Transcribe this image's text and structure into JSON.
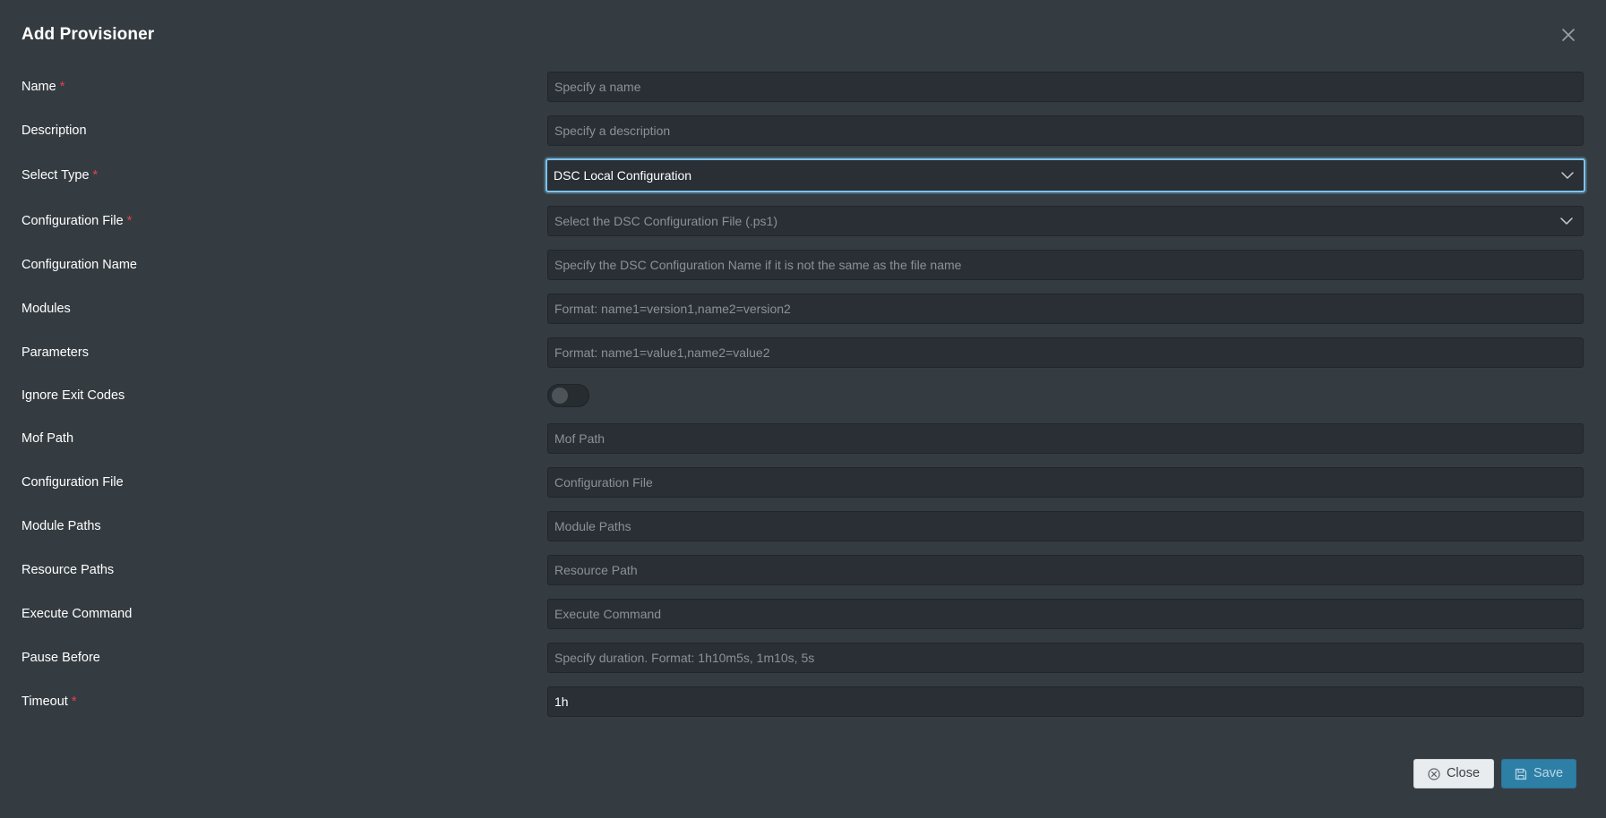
{
  "modal": {
    "title": "Add Provisioner"
  },
  "fields": {
    "name": {
      "label": "Name",
      "placeholder": "Specify a name",
      "required": "*"
    },
    "description": {
      "label": "Description",
      "placeholder": "Specify a description"
    },
    "select_type": {
      "label": "Select Type",
      "value": "DSC Local Configuration",
      "required": "*"
    },
    "configuration_file_select": {
      "label": "Configuration File",
      "placeholder": "Select the DSC Configuration File (.ps1)",
      "required": "*"
    },
    "configuration_name": {
      "label": "Configuration Name",
      "placeholder": "Specify the DSC Configuration Name if it is not the same as the file name"
    },
    "modules": {
      "label": "Modules",
      "placeholder": "Format: name1=version1,name2=version2"
    },
    "parameters": {
      "label": "Parameters",
      "placeholder": "Format: name1=value1,name2=value2"
    },
    "ignore_exit_codes": {
      "label": "Ignore Exit Codes",
      "enabled": false
    },
    "mof_path": {
      "label": "Mof Path",
      "placeholder": "Mof Path"
    },
    "configuration_file": {
      "label": "Configuration File",
      "placeholder": "Configuration File"
    },
    "module_paths": {
      "label": "Module Paths",
      "placeholder": "Module Paths"
    },
    "resource_paths": {
      "label": "Resource Paths",
      "placeholder": "Resource Path"
    },
    "execute_command": {
      "label": "Execute Command",
      "placeholder": "Execute Command"
    },
    "pause_before": {
      "label": "Pause Before",
      "placeholder": "Specify duration. Format: 1h10m5s, 1m10s, 5s"
    },
    "timeout": {
      "label": "Timeout",
      "value": "1h",
      "required": "*"
    }
  },
  "footer": {
    "close_label": "Close",
    "save_label": "Save"
  },
  "icons": {
    "close": "close-icon",
    "chevron": "chevron-down-icon",
    "close_circle": "close-circle-icon",
    "save": "save-icon"
  },
  "colors": {
    "background": "#353c41",
    "input_bg": "#292f34",
    "focus_border": "#7cc3ee",
    "required": "#e0434f",
    "save_bg": "#2e7fa6",
    "close_bg": "#e9ecef"
  }
}
